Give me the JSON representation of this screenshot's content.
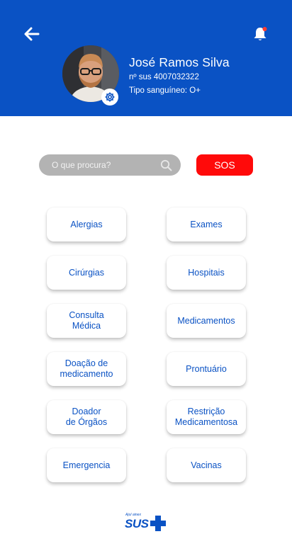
{
  "header": {
    "name": "José Ramos Silva",
    "sus_number": "nº sus 4007032322",
    "blood_type": "Tipo sanguíneo: O+"
  },
  "search": {
    "placeholder": "O que procura?"
  },
  "sos_label": "SOS",
  "menu": {
    "items": [
      {
        "label": "Alergias"
      },
      {
        "label": "Exames"
      },
      {
        "label": "Cirúrgias"
      },
      {
        "label": "Hospitais"
      },
      {
        "label": "Consulta\nMédica"
      },
      {
        "label": "Medicamentos"
      },
      {
        "label": "Doação de\nmedicamento"
      },
      {
        "label": "Prontuário"
      },
      {
        "label": "Doador\nde Órgãos"
      },
      {
        "label": "Restrição\nMedicamentosa"
      },
      {
        "label": "Emergencia"
      },
      {
        "label": "Vacinas"
      }
    ]
  },
  "footer": {
    "logo_tagline": "Ajuí ainex",
    "logo_text": "SUS"
  },
  "colors": {
    "primary": "#0a52c4",
    "sos": "#ff0a0a",
    "notification_dot": "#ff3b30",
    "search_bg": "#b3b3b3"
  },
  "icons": {
    "back": "arrow-left-icon",
    "notification": "bell-icon",
    "settings": "gear-icon",
    "search": "search-icon"
  }
}
